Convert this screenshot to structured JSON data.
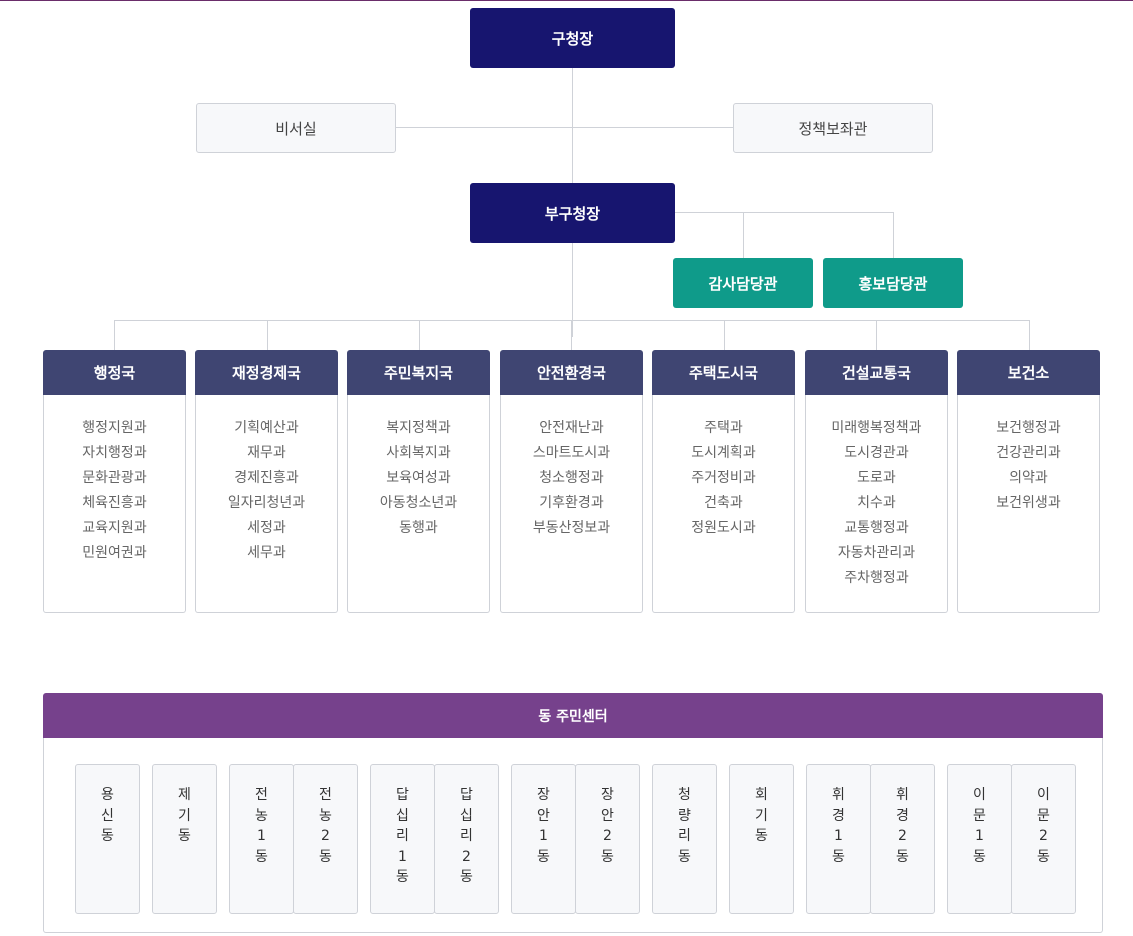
{
  "top": {
    "head": "구청장",
    "left_staff": "비서실",
    "right_staff": "정책보좌관"
  },
  "deputy": {
    "head": "부구청장",
    "officers": [
      "감사담당관",
      "홍보담당관"
    ]
  },
  "bureaus": [
    {
      "name": "행정국",
      "depts": [
        "행정지원과",
        "자치행정과",
        "문화관광과",
        "체육진흥과",
        "교육지원과",
        "민원여권과"
      ]
    },
    {
      "name": "재정경제국",
      "depts": [
        "기획예산과",
        "재무과",
        "경제진흥과",
        "일자리청년과",
        "세정과",
        "세무과"
      ]
    },
    {
      "name": "주민복지국",
      "depts": [
        "복지정책과",
        "사회복지과",
        "보육여성과",
        "아동청소년과",
        "동행과"
      ]
    },
    {
      "name": "안전환경국",
      "depts": [
        "안전재난과",
        "스마트도시과",
        "청소행정과",
        "기후환경과",
        "부동산정보과"
      ]
    },
    {
      "name": "주택도시국",
      "depts": [
        "주택과",
        "도시계획과",
        "주거정비과",
        "건축과",
        "정원도시과"
      ]
    },
    {
      "name": "건설교통국",
      "depts": [
        "미래행복정책과",
        "도시경관과",
        "도로과",
        "치수과",
        "교통행정과",
        "자동차관리과",
        "주차행정과"
      ]
    },
    {
      "name": "보건소",
      "depts": [
        "보건행정과",
        "건강관리과",
        "의약과",
        "보건위생과"
      ]
    }
  ],
  "community": {
    "title": "동 주민센터",
    "dongs": [
      "용신동",
      "제기동",
      "전농1동",
      "전농2동",
      "답십리1동",
      "답십리2동",
      "장안1동",
      "장안2동",
      "청량리동",
      "회기동",
      "휘경1동",
      "휘경2동",
      "이문1동",
      "이문2동"
    ]
  }
}
